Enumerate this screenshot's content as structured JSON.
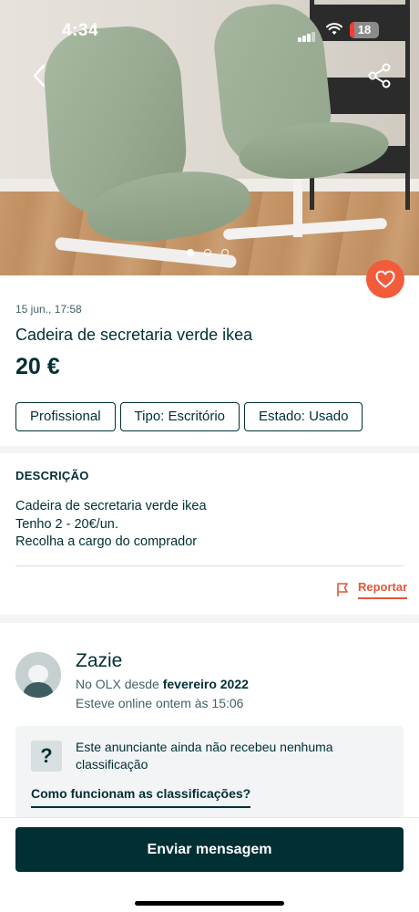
{
  "status_bar": {
    "time": "4:34",
    "battery": "18"
  },
  "gallery": {
    "photo_count": 3,
    "active_index": 0,
    "photo_alt": "Cadeira de secretaria verde ikea"
  },
  "listing": {
    "posted": "15 jun., 17:58",
    "title": "Cadeira de secretaria verde ikea",
    "price": "20 €",
    "tags": [
      "Profissional",
      "Tipo: Escritório",
      "Estado: Usado"
    ]
  },
  "description": {
    "heading": "DESCRIÇÃO",
    "lines": [
      "Cadeira de secretaria verde ikea",
      "Tenho 2 - 20€/un.",
      "Recolha a cargo do comprador"
    ]
  },
  "report": {
    "label": "Reportar"
  },
  "seller": {
    "name": "Zazie",
    "since_prefix": "No OLX desde ",
    "since_date": "fevereiro 2022",
    "online": "Esteve online ontem às 15:06"
  },
  "rating": {
    "icon": "?",
    "text": "Este anunciante ainda não recebeu nenhuma classificação",
    "link": "Como funcionam as classificações?"
  },
  "actions": {
    "send_message": "Enviar mensagem"
  },
  "colors": {
    "brand_dark": "#002f34",
    "accent": "#f25c3b",
    "report": "#e2583a"
  }
}
